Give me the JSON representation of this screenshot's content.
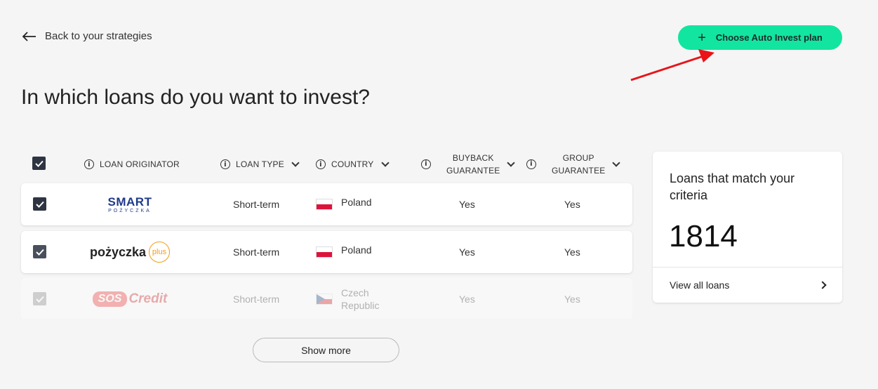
{
  "nav": {
    "back_label": "Back to your strategies"
  },
  "cta": {
    "label": "Choose Auto Invest plan",
    "color": "#12e5a0"
  },
  "annotation": {
    "arrow_color": "#e8141a"
  },
  "title": "In which loans do you want to invest?",
  "table": {
    "headers": {
      "originator": "LOAN ORIGINATOR",
      "loan_type": "LOAN TYPE",
      "country": "COUNTRY",
      "buyback_1": "BUYBACK",
      "buyback_2": "GUARANTEE",
      "group_1": "GROUP",
      "group_2": "GUARANTEE"
    },
    "rows": [
      {
        "logo_main": "SMART",
        "logo_sub": "POŻYCZKA",
        "loan_type": "Short-term",
        "flag": "poland-flag",
        "country": "Poland",
        "buyback": "Yes",
        "group": "Yes"
      },
      {
        "logo_main": "pożyczka",
        "logo_sub": "plus",
        "loan_type": "Short-term",
        "flag": "poland-flag",
        "country": "Poland",
        "buyback": "Yes",
        "group": "Yes"
      },
      {
        "logo_main": "SOS",
        "logo_sub": "Credit",
        "loan_type": "Short-term",
        "flag": "czech-flag",
        "country_1": "Czech",
        "country_2": "Republic",
        "buyback": "Yes",
        "group": "Yes"
      }
    ]
  },
  "show_more": "Show more",
  "match_card": {
    "title": "Loans that match your criteria",
    "count": "1814",
    "link": "View all loans"
  }
}
